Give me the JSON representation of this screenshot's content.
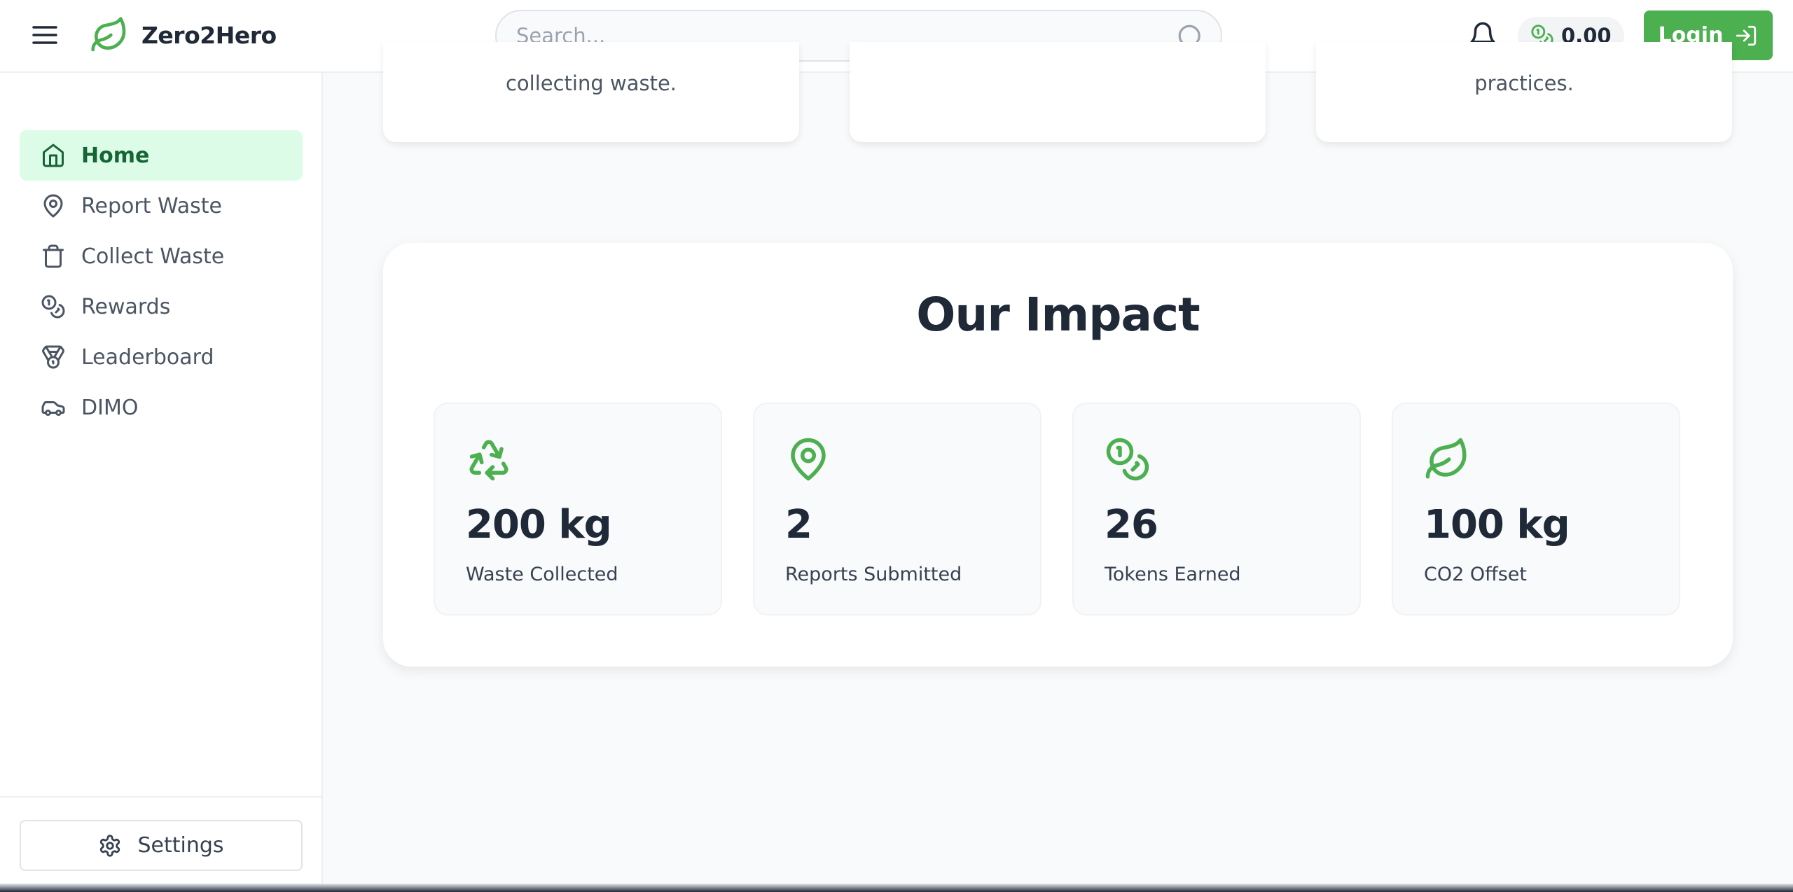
{
  "header": {
    "app_name": "Zero2Hero",
    "search_placeholder": "Search...",
    "balance": "0.00",
    "login_label": "Login"
  },
  "sidebar": {
    "items": [
      {
        "label": "Home",
        "icon": "home-icon",
        "active": true
      },
      {
        "label": "Report Waste",
        "icon": "map-pin-icon"
      },
      {
        "label": "Collect Waste",
        "icon": "trash-icon"
      },
      {
        "label": "Rewards",
        "icon": "coins-icon"
      },
      {
        "label": "Leaderboard",
        "icon": "medal-icon"
      },
      {
        "label": "DIMO",
        "icon": "car-icon"
      }
    ],
    "settings_label": "Settings"
  },
  "feature_cards": [
    {
      "text": "collecting waste."
    },
    {
      "text": ""
    },
    {
      "text": "practices."
    }
  ],
  "impact": {
    "title": "Our Impact",
    "stats": [
      {
        "value": "200 kg",
        "label": "Waste Collected",
        "icon": "recycle-icon"
      },
      {
        "value": "2",
        "label": "Reports Submitted",
        "icon": "map-pin-icon"
      },
      {
        "value": "26",
        "label": "Tokens Earned",
        "icon": "coins-icon"
      },
      {
        "value": "100 kg",
        "label": "CO2 Offset",
        "icon": "leaf-icon"
      }
    ]
  },
  "colors": {
    "accent": "#4caf50",
    "active_bg": "#dcfce7",
    "active_text": "#166534",
    "icon_green": "#4caf50"
  }
}
